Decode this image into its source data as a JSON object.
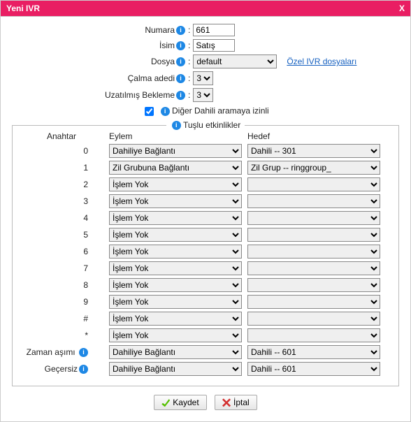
{
  "title": "Yeni IVR",
  "close_label": "X",
  "labels": {
    "numara": "Numara",
    "isim": "İsim",
    "dosya": "Dosya",
    "calma": "Çalma adedi",
    "uzatilmis": "Uzatılmış Bekleme",
    "diger_dahili": "Diğer Dahili aramaya izinli",
    "tuslu": "Tuşlu etkinlikler",
    "anahtar": "Anahtar",
    "eylem": "Eylem",
    "hedef": "Hedef",
    "zaman": "Zaman aşımı",
    "gecersiz": "Geçersiz",
    "ozel_ivr": "Özel IVR dosyaları"
  },
  "vals": {
    "numara": "661",
    "isim": "Satış",
    "dosya": "default",
    "calma": "3",
    "uzatilmis": "3",
    "diger_checked": true
  },
  "btns": {
    "save": "Kaydet",
    "cancel": "İptal"
  },
  "options": {
    "actions": [
      "Dahiliye Bağlantı",
      "Zil Grubuna Bağlantı",
      "İşlem Yok"
    ],
    "targets": [
      "Dahili -- 301",
      "Zil Grup -- ringgroup_",
      "Dahili -- 601",
      ""
    ]
  },
  "keys": [
    {
      "k": "0",
      "action": "Dahiliye Bağlantı",
      "target": "Dahili -- 301"
    },
    {
      "k": "1",
      "action": "Zil Grubuna Bağlantı",
      "target": "Zil Grup -- ringgroup_"
    },
    {
      "k": "2",
      "action": "İşlem Yok",
      "target": ""
    },
    {
      "k": "3",
      "action": "İşlem Yok",
      "target": ""
    },
    {
      "k": "4",
      "action": "İşlem Yok",
      "target": ""
    },
    {
      "k": "5",
      "action": "İşlem Yok",
      "target": ""
    },
    {
      "k": "6",
      "action": "İşlem Yok",
      "target": ""
    },
    {
      "k": "7",
      "action": "İşlem Yok",
      "target": ""
    },
    {
      "k": "8",
      "action": "İşlem Yok",
      "target": ""
    },
    {
      "k": "9",
      "action": "İşlem Yok",
      "target": ""
    },
    {
      "k": "#",
      "action": "İşlem Yok",
      "target": ""
    },
    {
      "k": "*",
      "action": "İşlem Yok",
      "target": ""
    }
  ],
  "timeout": {
    "action": "Dahiliye Bağlantı",
    "target": "Dahili -- 601"
  },
  "invalid": {
    "action": "Dahiliye Bağlantı",
    "target": "Dahili -- 601"
  }
}
